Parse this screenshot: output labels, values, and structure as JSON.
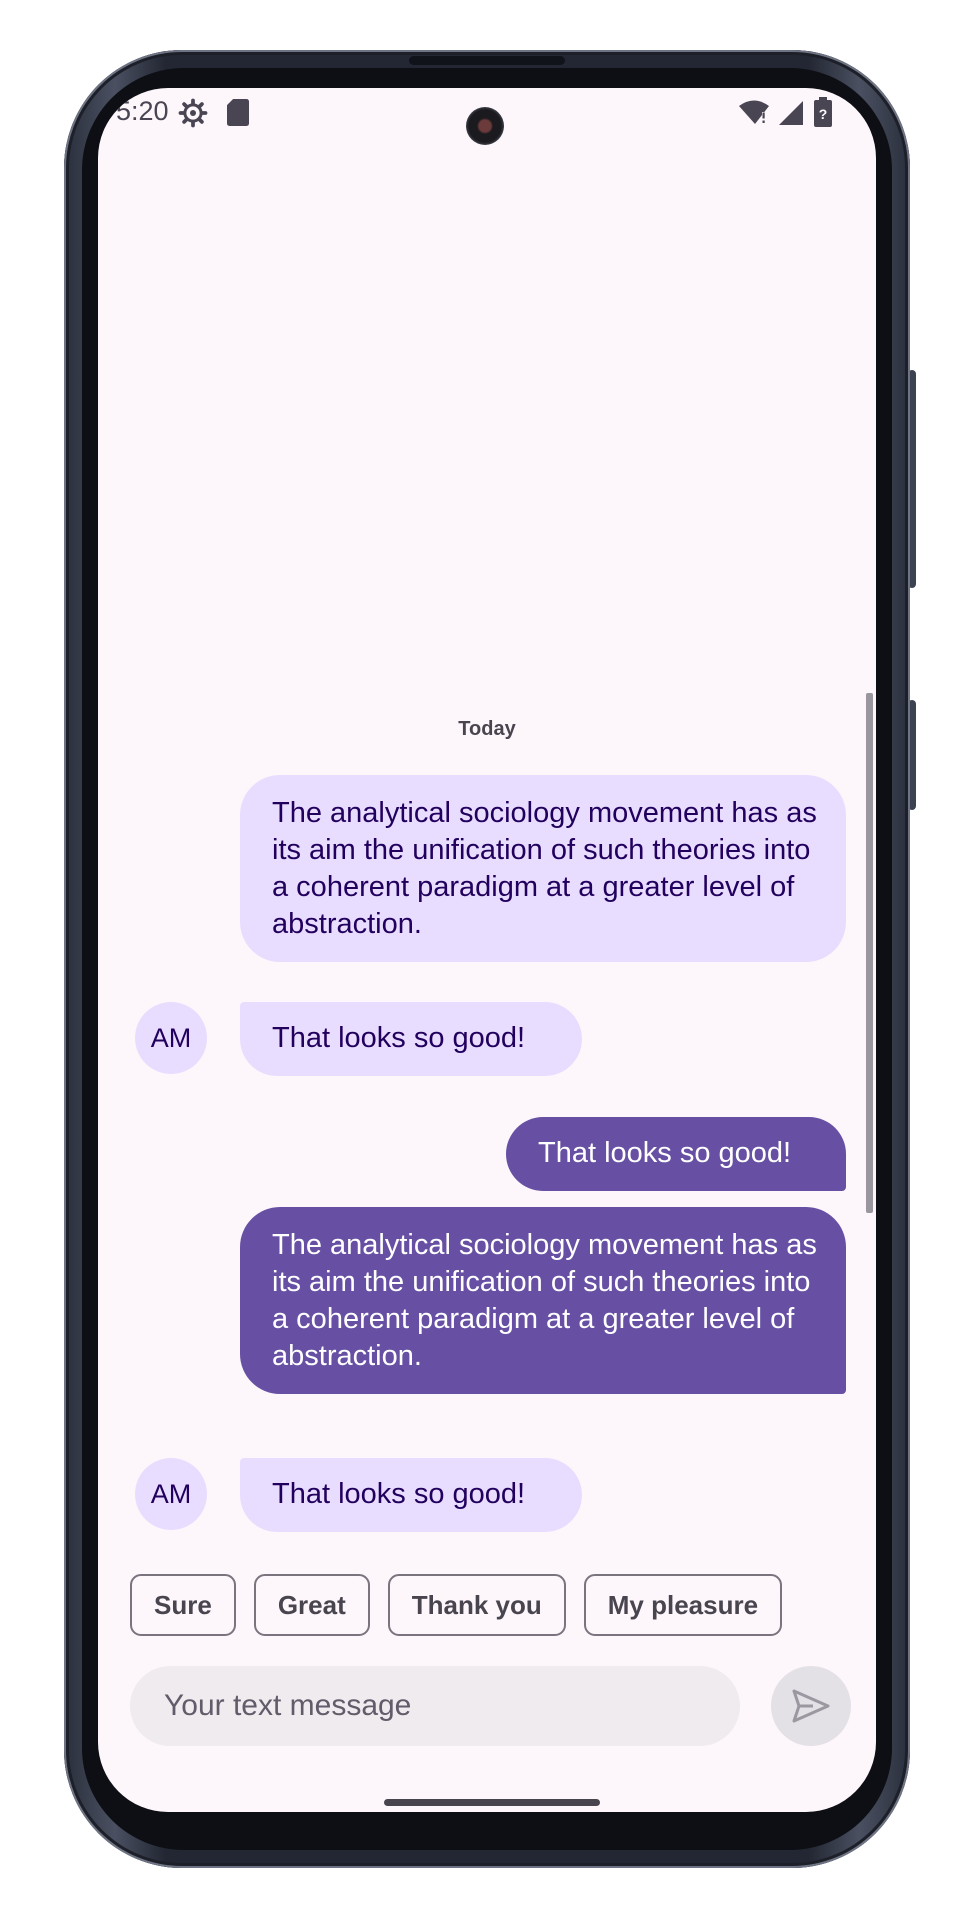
{
  "status_bar": {
    "time": "5:20",
    "icons": [
      "settings-gear-icon",
      "sd-card-icon",
      "wifi-alert-icon",
      "cell-signal-icon",
      "battery-unknown-icon"
    ]
  },
  "conversation": {
    "date_label": "Today",
    "messages": [
      {
        "sender": "me",
        "style": "light",
        "text": "The analytical sociology movement has as its aim the unification of such theories into a coherent paradigm at a greater level of abstraction."
      },
      {
        "sender": "AM",
        "avatar": "AM",
        "style": "light",
        "text": "That looks so good!"
      },
      {
        "sender": "me",
        "style": "dark",
        "text": "That looks so good!"
      },
      {
        "sender": "me",
        "style": "dark",
        "text": "The analytical sociology movement has as its aim the unification of such theories into a coherent paradigm at a greater level of abstraction."
      },
      {
        "sender": "AM",
        "avatar": "AM",
        "style": "light",
        "text": "That looks so good!"
      }
    ]
  },
  "smart_replies": [
    "Sure",
    "Great",
    "Thank you",
    "My pleasure"
  ],
  "composer": {
    "placeholder": "Your text message",
    "value": "",
    "send_icon": "send-icon"
  },
  "colors": {
    "bubble_light": "#e8ddff",
    "bubble_dark": "#6750a4",
    "background": "#fdf7fc",
    "text_on_light": "#22005d"
  }
}
